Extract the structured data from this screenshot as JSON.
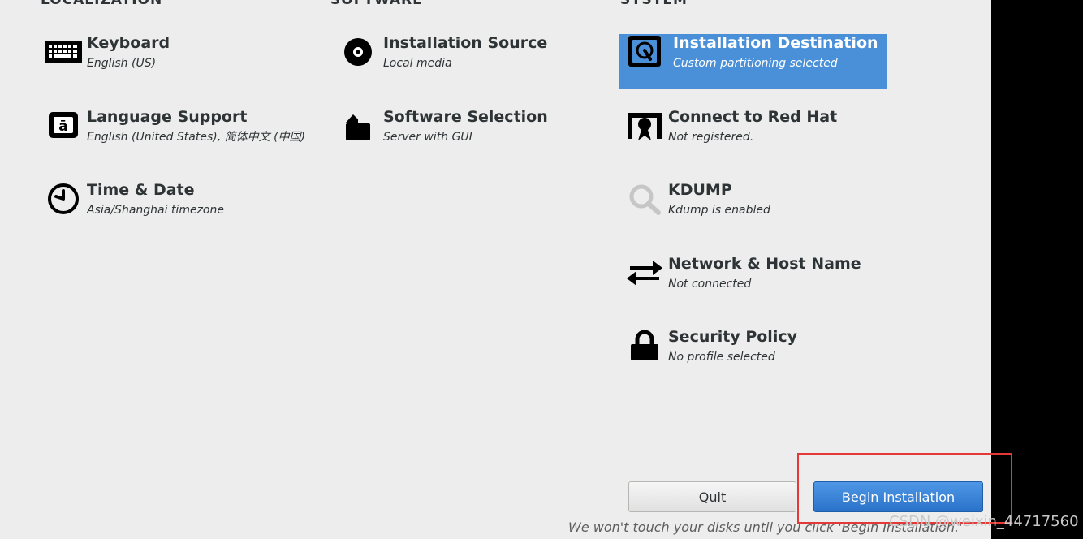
{
  "sections": {
    "localization": "LOCALIZATION",
    "software": "SOFTWARE",
    "system": "SYSTEM"
  },
  "localization": {
    "keyboard": {
      "title": "Keyboard",
      "status": "English (US)",
      "icon": "keyboard-icon"
    },
    "language": {
      "title": "Language Support",
      "status": "English (United States), 简体中文 (中国)",
      "icon": "language-icon"
    },
    "time": {
      "title": "Time & Date",
      "status": "Asia/Shanghai timezone",
      "icon": "clock-icon"
    }
  },
  "software": {
    "source": {
      "title": "Installation Source",
      "status": "Local media",
      "icon": "disc-icon"
    },
    "selection": {
      "title": "Software Selection",
      "status": "Server with GUI",
      "icon": "package-icon"
    }
  },
  "system": {
    "destination": {
      "title": "Installation Destination",
      "status": "Custom partitioning selected",
      "icon": "harddisk-icon"
    },
    "redhat": {
      "title": "Connect to Red Hat",
      "status": "Not registered.",
      "icon": "redhat-icon"
    },
    "kdump": {
      "title": "KDUMP",
      "status": "Kdump is enabled",
      "icon": "magnifier-icon"
    },
    "network": {
      "title": "Network & Host Name",
      "status": "Not connected",
      "icon": "network-arrows-icon"
    },
    "security": {
      "title": "Security Policy",
      "status": "No profile selected",
      "icon": "lock-icon"
    }
  },
  "buttons": {
    "quit": "Quit",
    "begin": "Begin Installation"
  },
  "footer_note": "We won't touch your disks until you click 'Begin Installation.'",
  "watermark": "CSDN @weixin_44717560",
  "colors": {
    "selected_bg": "#4a90d9",
    "begin_btn": "#3584e4",
    "highlight_box": "#e53935"
  }
}
